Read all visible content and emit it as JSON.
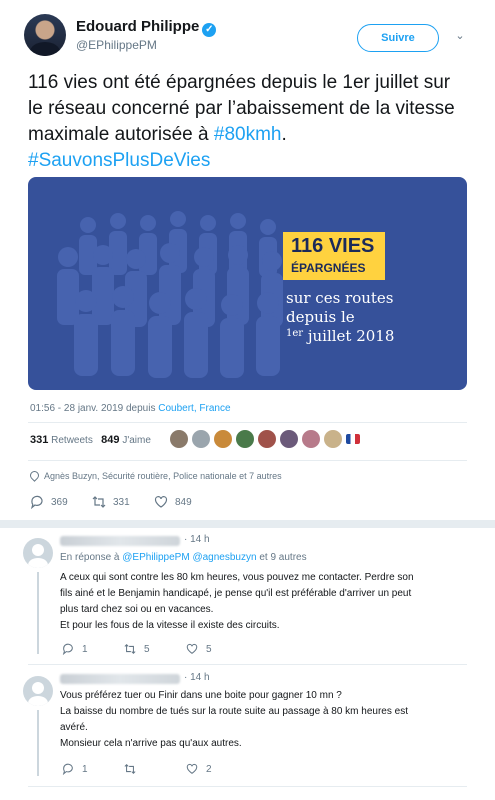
{
  "tweet": {
    "author_name": "Edouard Philippe",
    "author_handle": "@EPhilippePM",
    "follow_label": "Suivre",
    "text_plain": "116 vies ont été épargnées depuis le 1er juillet sur le réseau concerné par l’abaissement de la vitesse maximale autorisée à",
    "hashtag1": "#80kmh",
    "dot": ".",
    "hashtag2": "#SauvonsPlusDeVies",
    "image": {
      "big": "116 VIES",
      "small": "ÉPARGNÉES",
      "line1": "sur ces routes",
      "line2": "depuis le",
      "line3_sup": "1er",
      "line3_rest": " juillet 2018"
    },
    "timestamp": "01:56 - 28 janv. 2019 depuis",
    "location": "Coubert, France",
    "retweets_count": "331",
    "retweets_label": "Retweets",
    "likes_count": "849",
    "likes_label": "J'aime",
    "people": "Agnès Buzyn, Sécurité routière, Police nationale et 7 autres",
    "actions": {
      "replies": "369",
      "retweets": "331",
      "likes": "849"
    }
  },
  "replies": [
    {
      "time": "· 14 h",
      "in_reply_prefix": "En réponse à",
      "in_reply_to": "@EPhilippePM @agnesbuzyn",
      "in_reply_suffix": "et 9 autres",
      "text_lines": [
        "A ceux qui sont contre les 80 km heures, vous pouvez me contacter. Perdre son",
        "fils ainé et le Benjamin handicapé, je pense qu'il est préférable d'arriver un peut",
        "plus tard chez soi ou en vacances.",
        "Et pour les fous de la vitesse il existe des circuits."
      ],
      "replies": "1",
      "retweets": "5",
      "likes": "5"
    },
    {
      "time": "· 14 h",
      "text_lines": [
        "Vous préférez tuer ou Finir dans une boite pour gagner 10 mn ?",
        "La baisse du nombre de tués sur la route suite au passage à 80 km heures est",
        "avéré.",
        "Monsieur cela n'arrive pas qu'aux autres."
      ],
      "replies": "1",
      "retweets": "",
      "likes": "2"
    }
  ],
  "colors": {
    "accent": "#1da1f2",
    "card_bg": "#36519a",
    "badge": "#ffd23f"
  }
}
